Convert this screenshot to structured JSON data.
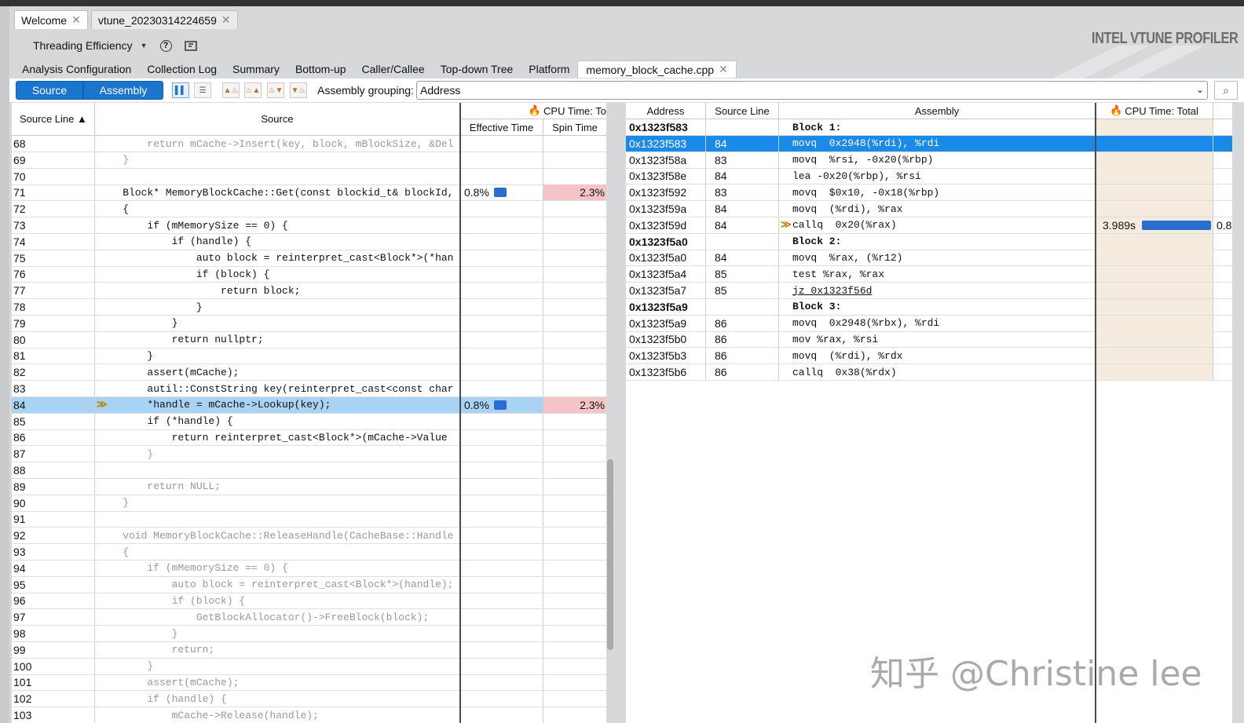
{
  "tabs": [
    {
      "label": "Welcome"
    },
    {
      "label": "vtune_20230314224659"
    }
  ],
  "toolbar": {
    "analysis_label": "Threading Efficiency"
  },
  "brand": "INTEL VTUNE PROFILER",
  "nav_tabs": [
    "Analysis Configuration",
    "Collection Log",
    "Summary",
    "Bottom-up",
    "Caller/Callee",
    "Top-down Tree",
    "Platform"
  ],
  "file_tab": {
    "label": "memory_block_cache.cpp"
  },
  "view": {
    "source_label": "Source",
    "assembly_label": "Assembly",
    "grouping_label": "Assembly grouping:",
    "grouping_value": "Address"
  },
  "left": {
    "headers": {
      "source_line": "Source Line ▲",
      "source": "Source",
      "cpu_group": "CPU Time: To",
      "effective": "Effective Time",
      "spin": "Spin Time"
    },
    "rows": [
      {
        "line": "68",
        "code": "        return mCache->Insert(key, block, mBlockSize, &Del",
        "dim": true
      },
      {
        "line": "69",
        "code": "    }",
        "dim": true
      },
      {
        "line": "70",
        "code": "",
        "dim": true
      },
      {
        "line": "71",
        "code": "    Block* MemoryBlockCache::Get(const blockid_t& blockId,",
        "eff": "0.8%",
        "effbar": 0.1,
        "spin": "2.3%"
      },
      {
        "line": "72",
        "code": "    {"
      },
      {
        "line": "73",
        "code": "        if (mMemorySize == 0) {"
      },
      {
        "line": "74",
        "code": "            if (handle) {"
      },
      {
        "line": "75",
        "code": "                auto block = reinterpret_cast<Block*>(*han"
      },
      {
        "line": "76",
        "code": "                if (block) {"
      },
      {
        "line": "77",
        "code": "                    return block;"
      },
      {
        "line": "78",
        "code": "                }"
      },
      {
        "line": "79",
        "code": "            }"
      },
      {
        "line": "80",
        "code": "            return nullptr;"
      },
      {
        "line": "81",
        "code": "        }"
      },
      {
        "line": "82",
        "code": "        assert(mCache);"
      },
      {
        "line": "83",
        "code": "        autil::ConstString key(reinterpret_cast<const char"
      },
      {
        "line": "84",
        "code": "        *handle = mCache->Lookup(key);",
        "eff": "0.8%",
        "effbar": 0.1,
        "spin": "2.3%",
        "selected": true
      },
      {
        "line": "85",
        "code": "        if (*handle) {"
      },
      {
        "line": "86",
        "code": "            return reinterpret_cast<Block*>(mCache->Value"
      },
      {
        "line": "87",
        "code": "        }",
        "dim": true
      },
      {
        "line": "88",
        "code": "",
        "dim": true
      },
      {
        "line": "89",
        "code": "        return NULL;",
        "dim": true
      },
      {
        "line": "90",
        "code": "    }",
        "dim": true
      },
      {
        "line": "91",
        "code": "",
        "dim": true
      },
      {
        "line": "92",
        "code": "    void MemoryBlockCache::ReleaseHandle(CacheBase::Handle",
        "dim": true
      },
      {
        "line": "93",
        "code": "    {",
        "dim": true
      },
      {
        "line": "94",
        "code": "        if (mMemorySize == 0) {",
        "dim": true
      },
      {
        "line": "95",
        "code": "            auto block = reinterpret_cast<Block*>(handle);",
        "dim": true
      },
      {
        "line": "96",
        "code": "            if (block) {",
        "dim": true
      },
      {
        "line": "97",
        "code": "                GetBlockAllocator()->FreeBlock(block);",
        "dim": true
      },
      {
        "line": "98",
        "code": "            }",
        "dim": true
      },
      {
        "line": "99",
        "code": "            return;",
        "dim": true
      },
      {
        "line": "100",
        "code": "        }",
        "dim": true
      },
      {
        "line": "101",
        "code": "        assert(mCache);",
        "dim": true
      },
      {
        "line": "102",
        "code": "        if (handle) {",
        "dim": true
      },
      {
        "line": "103",
        "code": "            mCache->Release(handle);",
        "dim": true
      }
    ]
  },
  "right": {
    "headers": {
      "address": "Address",
      "source_line": "Source Line",
      "assembly": "Assembly",
      "cpu": "CPU Time: Total"
    },
    "rows": [
      {
        "addr": "0x1323f583",
        "line": "",
        "asm": "Block 1:",
        "block": true
      },
      {
        "addr": "0x1323f583",
        "line": "84",
        "asm": "movq  0x2948(%rdi), %rdi",
        "selected": true
      },
      {
        "addr": "0x1323f58a",
        "line": "83",
        "asm": "movq  %rsi, -0x20(%rbp)"
      },
      {
        "addr": "0x1323f58e",
        "line": "84",
        "asm": "lea -0x20(%rbp), %rsi"
      },
      {
        "addr": "0x1323f592",
        "line": "83",
        "asm": "movq  $0x10, -0x18(%rbp)"
      },
      {
        "addr": "0x1323f59a",
        "line": "84",
        "asm": "movq  (%rdi), %rax"
      },
      {
        "addr": "0x1323f59d",
        "line": "84",
        "asm": "callq  0x20(%rax)",
        "cpu": "3.989s",
        "cpubar": 1.0,
        "cpu2": "0.8",
        "hot": true
      },
      {
        "addr": "0x1323f5a0",
        "line": "",
        "asm": "Block 2:",
        "block": true
      },
      {
        "addr": "0x1323f5a0",
        "line": "84",
        "asm": "movq  %rax, (%r12)"
      },
      {
        "addr": "0x1323f5a4",
        "line": "85",
        "asm": "test %rax, %rax"
      },
      {
        "addr": "0x1323f5a7",
        "line": "85",
        "asm": "jz 0x1323f56d",
        "link": true
      },
      {
        "addr": "0x1323f5a9",
        "line": "",
        "asm": "Block 3:",
        "block": true
      },
      {
        "addr": "0x1323f5a9",
        "line": "86",
        "asm": "movq  0x2948(%rbx), %rdi"
      },
      {
        "addr": "0x1323f5b0",
        "line": "86",
        "asm": "mov %rax, %rsi"
      },
      {
        "addr": "0x1323f5b3",
        "line": "86",
        "asm": "movq  (%rdi), %rdx"
      },
      {
        "addr": "0x1323f5b6",
        "line": "86",
        "asm": "callq  0x38(%rdx)"
      }
    ]
  },
  "watermark": "知乎 @Christine lee"
}
